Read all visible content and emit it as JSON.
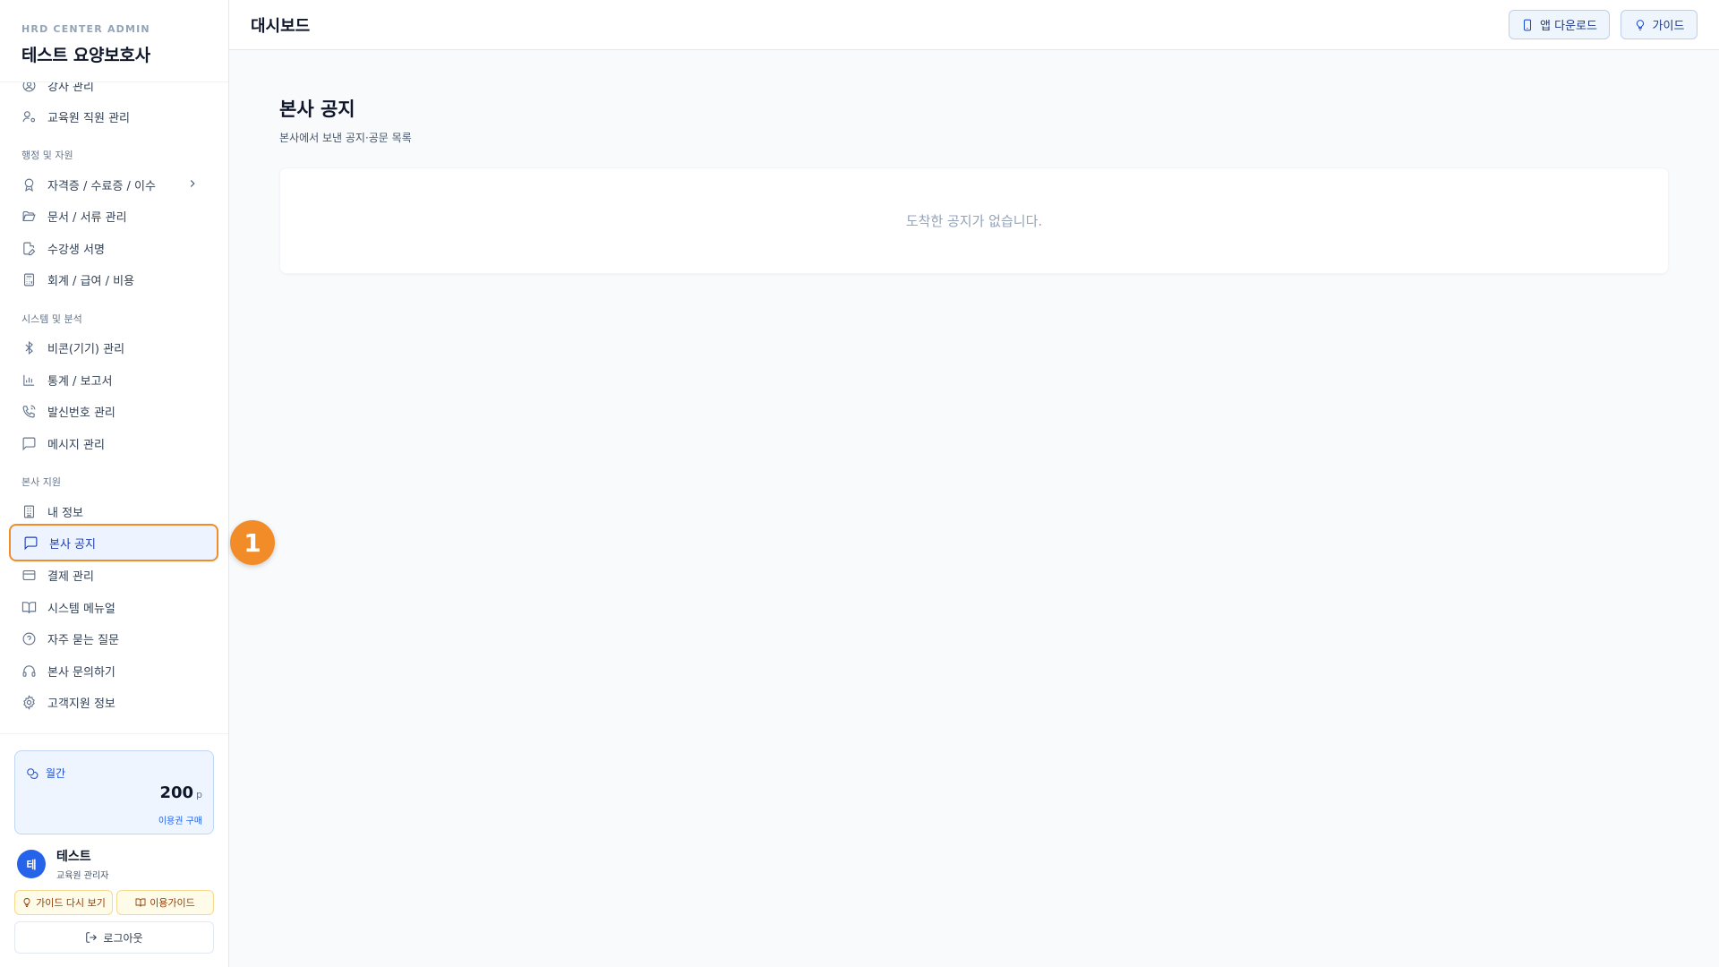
{
  "brand": {
    "subtitle": "HRD CENTER ADMIN",
    "title": "테스트 요양보호사"
  },
  "nav": {
    "items": [
      {
        "label": "강사 관리",
        "icon": "user-circle-icon"
      },
      {
        "label": "교육원 직원 관리",
        "icon": "user-cog-icon"
      },
      {
        "label": "자격증 / 수료증 / 이수",
        "icon": "award-icon"
      },
      {
        "label": "문서 / 서류 관리",
        "icon": "folder-open-icon"
      },
      {
        "label": "수강생 서명",
        "icon": "edit-file-icon"
      },
      {
        "label": "회계 / 급여 / 비용",
        "icon": "calculator-icon"
      },
      {
        "label": "비콘(기기) 관리",
        "icon": "bluetooth-icon"
      },
      {
        "label": "통계 / 보고서",
        "icon": "bar-chart-icon"
      },
      {
        "label": "발신번호 관리",
        "icon": "phone-icon"
      },
      {
        "label": "메시지 관리",
        "icon": "message-square-icon"
      },
      {
        "label": "내 정보",
        "icon": "building-icon"
      },
      {
        "label": "본사 공지",
        "icon": "message-square-icon",
        "active": true
      },
      {
        "label": "결제 관리",
        "icon": "credit-card-icon"
      },
      {
        "label": "시스템 메뉴얼",
        "icon": "book-open-icon"
      },
      {
        "label": "자주 묻는 질문",
        "icon": "help-circle-icon"
      },
      {
        "label": "본사 문의하기",
        "icon": "headphones-icon"
      },
      {
        "label": "고객지원 정보",
        "icon": "gear-icon"
      }
    ],
    "sections": [
      "행정 및 자원",
      "시스템 및 분석",
      "본사 지원"
    ]
  },
  "annotation": {
    "step": "1"
  },
  "plan": {
    "label": "월간",
    "value": "200",
    "unit": "p",
    "link": "이용권 구매"
  },
  "user": {
    "initial": "테",
    "name": "테스트",
    "role": "교육원 관리자"
  },
  "footer_buttons": {
    "guide_again": "가이드 다시 보기",
    "usage_guide": "이용가이드",
    "logout": "로그아웃"
  },
  "header": {
    "title": "대시보드",
    "app_download": "앱 다운로드",
    "guide": "가이드"
  },
  "main": {
    "title": "본사 공지",
    "subtitle": "본사에서 보낸 공지·공문 목록",
    "empty": "도착한 공지가 없습니다."
  },
  "colors": {
    "accent": "#2563eb",
    "highlight": "#f28c28"
  }
}
